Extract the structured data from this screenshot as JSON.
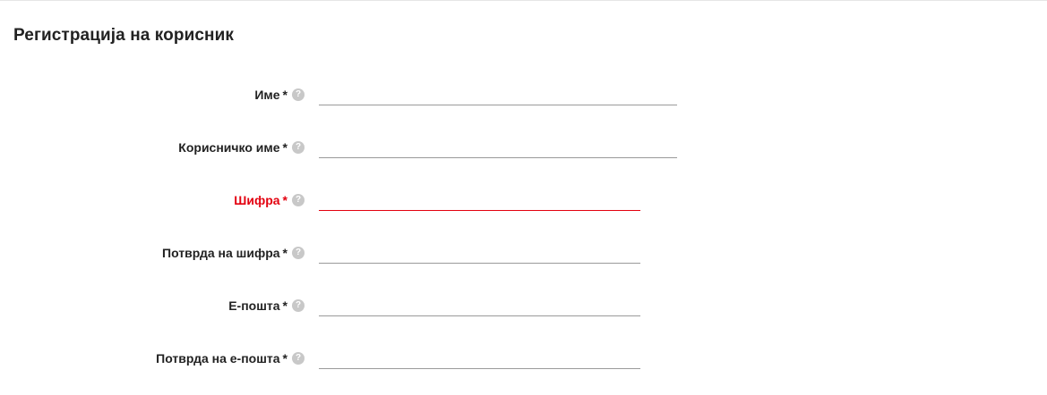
{
  "form": {
    "title": "Регистрација на корисник",
    "required_mark": "*",
    "help_glyph": "?",
    "error_color": "#e3000f",
    "fields": [
      {
        "label": "Име",
        "value": "",
        "state": "normal"
      },
      {
        "label": "Корисничко име",
        "value": "",
        "state": "normal"
      },
      {
        "label": "Шифра",
        "value": "",
        "state": "error"
      },
      {
        "label": "Потврда на шифра",
        "value": "",
        "state": "normal"
      },
      {
        "label": "Е-пошта",
        "value": "",
        "state": "normal"
      },
      {
        "label": "Потврда на е-пошта",
        "value": "",
        "state": "normal"
      }
    ]
  }
}
